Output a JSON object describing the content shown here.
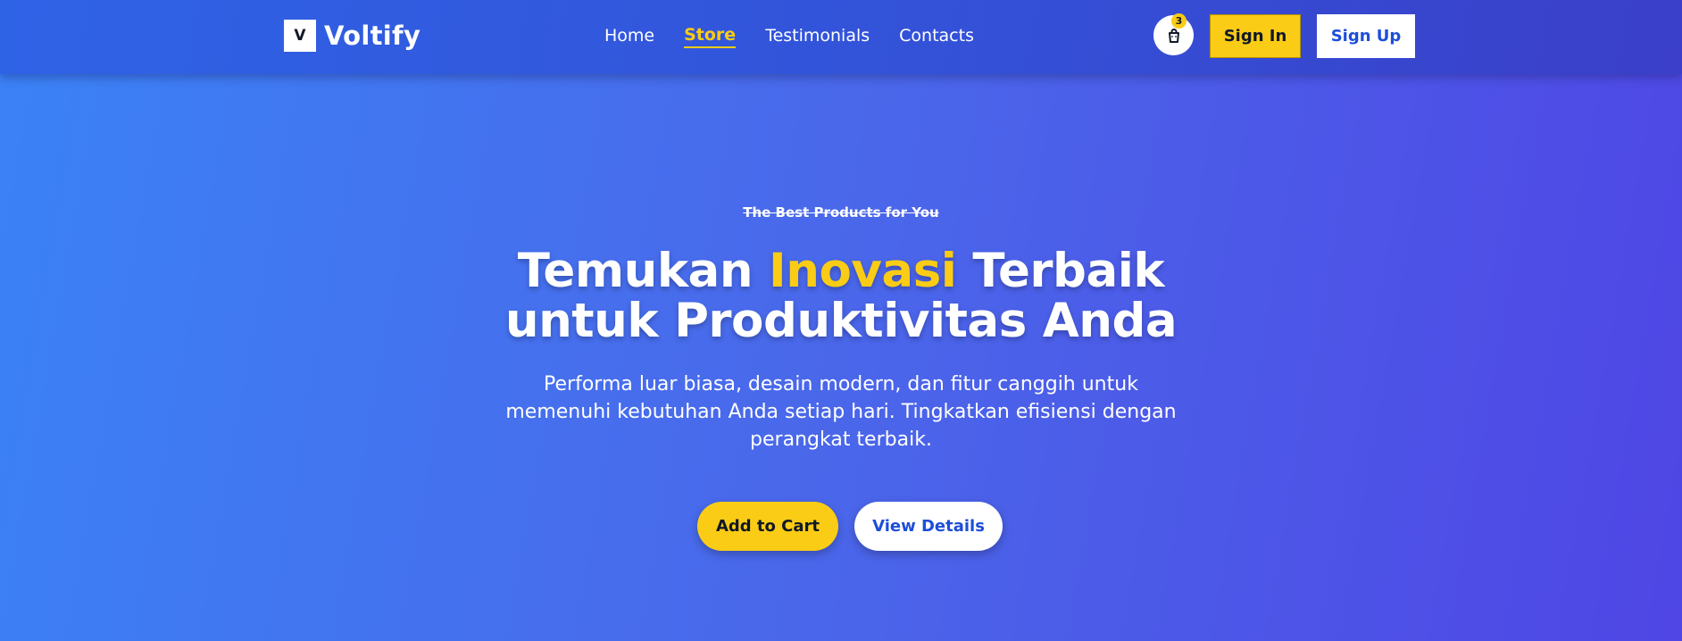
{
  "brand": {
    "logo_letter": "V",
    "name": "Voltify"
  },
  "nav": {
    "links": [
      {
        "label": "Home",
        "active": false
      },
      {
        "label": "Store",
        "active": true
      },
      {
        "label": "Testimonials",
        "active": false
      },
      {
        "label": "Contacts",
        "active": false
      }
    ]
  },
  "cart": {
    "icon": "shopping-bag-icon",
    "count": "3"
  },
  "auth": {
    "sign_in": "Sign In",
    "sign_up": "Sign Up"
  },
  "hero": {
    "eyebrow": "The Best Products for You",
    "headline_pre": "Temukan",
    "headline_highlight": "Inovasi",
    "headline_post": "Terbaik",
    "headline_line2": "untuk Produktivitas Anda",
    "description": "Performa luar biasa, desain modern, dan fitur canggih untuk memenuhi kebutuhan Anda setiap hari. Tingkatkan efisiensi dengan perangkat terbaik.",
    "primary_cta": "Add to Cart",
    "secondary_cta": "View Details"
  },
  "colors": {
    "accent": "#facc15",
    "primary": "#3b82f6",
    "primary_dark": "#4f46e5",
    "link_blue": "#1d4ed8"
  }
}
